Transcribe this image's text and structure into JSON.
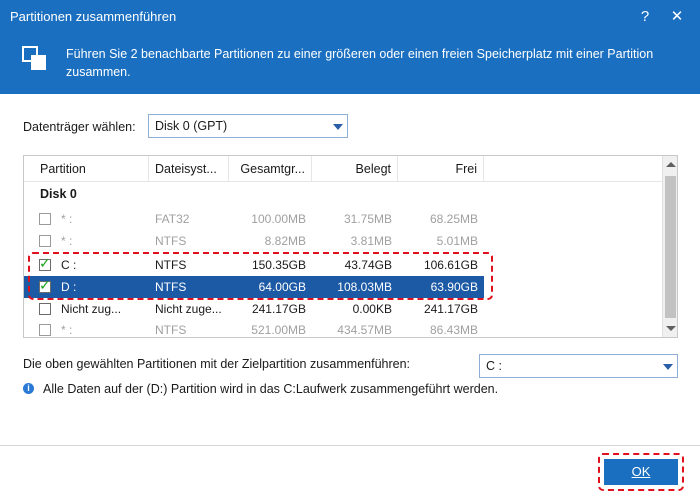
{
  "window": {
    "title": "Partitionen zusammenführen",
    "help_label": "?",
    "close_label": "✕",
    "description": "Führen Sie 2 benachbarte Partitionen zu einer größeren oder einen freien Speicherplatz mit einer Partition zusammen."
  },
  "disk_select": {
    "label": "Datenträger wählen:",
    "value": "Disk 0 (GPT)"
  },
  "table": {
    "columns": [
      "Partition",
      "Dateisyst...",
      "Gesamtgr...",
      "Belegt",
      "Frei"
    ],
    "group": "Disk 0",
    "rows": [
      {
        "partition": "* :",
        "fs": "FAT32",
        "total": "100.00MB",
        "used": "31.75MB",
        "free": "68.25MB",
        "checked": false,
        "enabled": false,
        "selected": false
      },
      {
        "partition": "* :",
        "fs": "NTFS",
        "total": "8.82MB",
        "used": "3.81MB",
        "free": "5.01MB",
        "checked": false,
        "enabled": false,
        "selected": false
      },
      {
        "partition": "C :",
        "fs": "NTFS",
        "total": "150.35GB",
        "used": "43.74GB",
        "free": "106.61GB",
        "checked": true,
        "enabled": true,
        "selected": false
      },
      {
        "partition": "D :",
        "fs": "NTFS",
        "total": "64.00GB",
        "used": "108.03MB",
        "free": "63.90GB",
        "checked": true,
        "enabled": true,
        "selected": true
      },
      {
        "partition": "Nicht zug...",
        "fs": "Nicht zuge...",
        "total": "241.17GB",
        "used": "0.00KB",
        "free": "241.17GB",
        "checked": false,
        "enabled": true,
        "selected": false
      },
      {
        "partition": "* :",
        "fs": "NTFS",
        "total": "521.00MB",
        "used": "434.57MB",
        "free": "86.43MB",
        "checked": false,
        "enabled": false,
        "selected": false
      }
    ]
  },
  "target": {
    "label": "Die oben gewählten Partitionen mit der Zielpartition zusammenführen:",
    "value": "C :"
  },
  "info": {
    "icon": "info-icon",
    "text": "Alle Daten auf der (D:) Partition wird in das C:Laufwerk zusammengeführt werden."
  },
  "footer": {
    "ok_label": "OK"
  },
  "colors": {
    "header": "#1a6fc0",
    "selected_row": "#1d5aa6",
    "highlight": "#e0101c",
    "check": "#1aa31a"
  }
}
